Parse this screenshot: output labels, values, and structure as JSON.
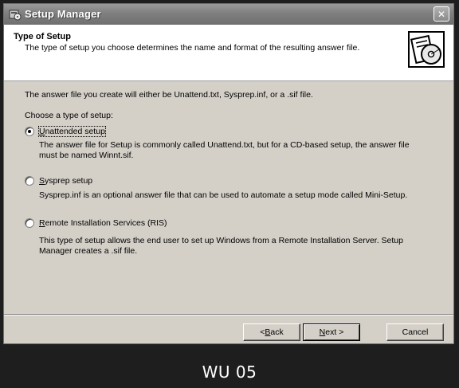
{
  "window": {
    "title": "Setup Manager",
    "close_glyph": "✕"
  },
  "header": {
    "title": "Type of Setup",
    "subtitle": "The type of setup you choose determines the name and format of the resulting answer file.",
    "icon": "setup-cd-icon"
  },
  "content": {
    "intro": "The answer file you create will either be Unattend.txt, Sysprep.inf, or a .sif file.",
    "choose_label": "Choose a type of setup:",
    "options": [
      {
        "access_key": "U",
        "label_rest": "nattended setup",
        "selected": true,
        "description": "The answer file for Setup is commonly called Unattend.txt, but for a CD-based setup, the answer file must be named Winnt.sif."
      },
      {
        "access_key": "S",
        "label_rest": "ysprep setup",
        "selected": false,
        "description": "Sysprep.inf is an optional answer file that can be used to automate a setup mode called Mini-Setup."
      },
      {
        "access_key": "R",
        "label_rest": "emote Installation Services (RIS)",
        "selected": false,
        "description": "This type of setup allows the end user to set up Windows from a Remote Installation Server. Setup Manager creates a .sif file."
      }
    ]
  },
  "buttons": {
    "back": {
      "prefix": "< ",
      "key": "B",
      "rest": "ack"
    },
    "next": {
      "key": "N",
      "rest": "ext >"
    },
    "cancel": "Cancel"
  },
  "caption": "WU 05"
}
